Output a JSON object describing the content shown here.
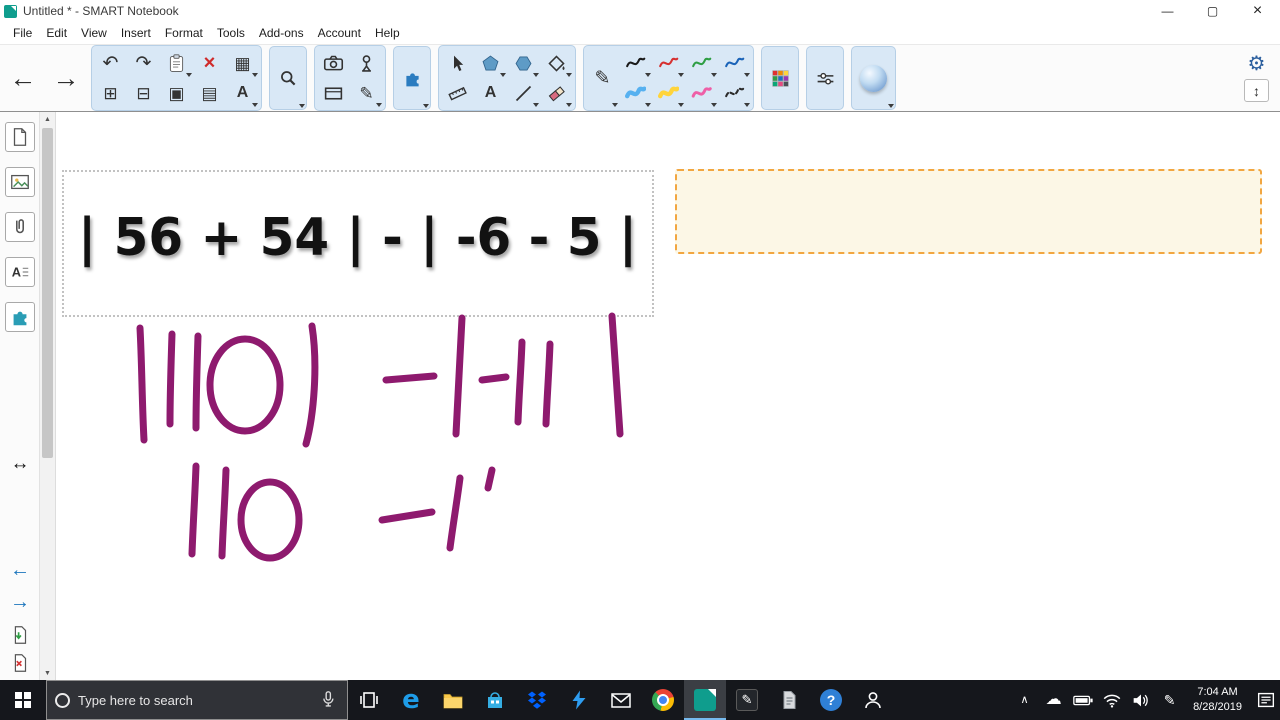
{
  "window": {
    "title": "Untitled * - SMART Notebook",
    "controls": {
      "minimize": "—",
      "maximize": "▢",
      "close": "×"
    }
  },
  "menu": {
    "items": [
      "File",
      "Edit",
      "View",
      "Insert",
      "Format",
      "Tools",
      "Add-ons",
      "Account",
      "Help"
    ]
  },
  "toolbar": {
    "glyphs": {
      "back": "←",
      "forward": "→",
      "undo": "↶",
      "redo": "↷",
      "delete": "×",
      "table": "▦",
      "add_page": "⊞",
      "delete_page": "⊟",
      "save": "▣",
      "screen_shade": "▤",
      "font": "A",
      "magic_pen": "✎",
      "text": "A",
      "pencil": "✎",
      "gear": "⚙",
      "page_sort": "↕"
    },
    "pen_colors": [
      "#1a1a1a",
      "#d63030",
      "#2e9e44",
      "#1a63b8"
    ],
    "highlighter_colors": [
      "#57b1f0",
      "#ffd43b",
      "#ee5fa7",
      "#2b2b2b"
    ],
    "grid_colors": [
      "#e03131",
      "#f08c00",
      "#ffd43b",
      "#2f9e44",
      "#1971c2",
      "#9c36b5",
      "#0ca678",
      "#e64980",
      "#495057"
    ],
    "group_bg_color": "#d9e8f6"
  },
  "sidebar": {
    "glyphs": {
      "resize": "↔",
      "prev": "←",
      "next": "→",
      "properties": "A"
    }
  },
  "canvas": {
    "expression": "| 56 + 54 | - | -6 - 5 |",
    "ink_line1": "|110| - |-11|",
    "ink_line2": "110 - 1",
    "ink_color": "#8e1a6e",
    "selection_border_color": "#c2c2c2",
    "answer_box": {
      "border_color": "#f2a640",
      "fill_color": "#fcf7e6"
    }
  },
  "taskbar": {
    "search_placeholder": "Type here to search",
    "clock": {
      "time": "7:04 AM",
      "date": "8/28/2019"
    },
    "glyphs": {
      "chevron": "∧",
      "cloud": "☁",
      "pen": "✎",
      "help": "?",
      "edge": "e"
    },
    "colors": {
      "smart_green": "#0f9d8d",
      "help_blue": "#2f80d6",
      "edge_blue": "#1e9ce8",
      "dropbox_blue": "#0062ff",
      "store_blue": "#35aee3",
      "folder_yellow": "#f9c84a"
    }
  }
}
